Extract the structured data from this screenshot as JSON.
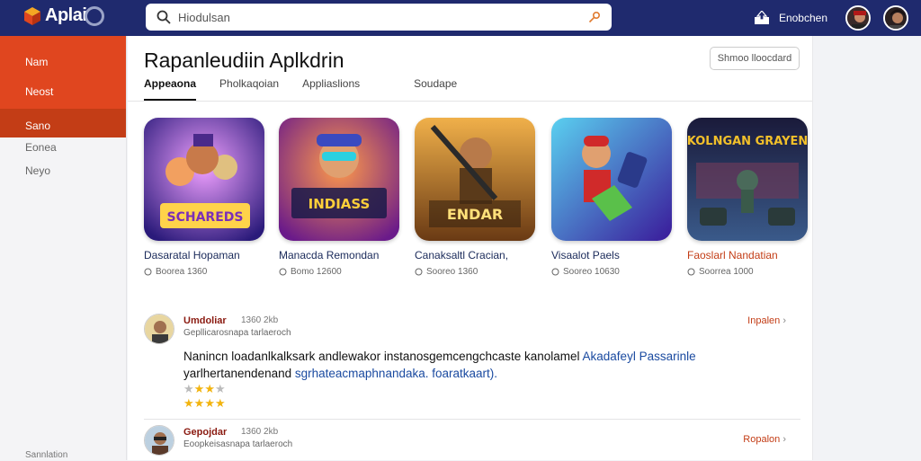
{
  "app": {
    "logo_text": "Aplai"
  },
  "search": {
    "value": "Hiodulsan"
  },
  "top_right": {
    "label": "Enobchen"
  },
  "sidebar": {
    "items": [
      {
        "label": "Nam"
      },
      {
        "label": "Neost"
      }
    ],
    "active": {
      "label": "Sano"
    },
    "plain": [
      {
        "label": "Eonea"
      },
      {
        "label": "Neyo"
      }
    ],
    "footer": "Sannlation"
  },
  "main": {
    "title": "Rapanleudiin Aplkdrin",
    "filter_button": "Shmoo lloocdard",
    "tabs": [
      {
        "label": "Appeaona"
      },
      {
        "label": "Pholkaqoian"
      },
      {
        "label": "Appliaslions"
      },
      {
        "label": "Soudape"
      }
    ]
  },
  "cards": [
    {
      "title": "Dasaratal Hopaman",
      "meta": "Boorea 1360",
      "art_text": "SCHAREDS",
      "accent": "#7a2fb8"
    },
    {
      "title": "Manacda Remondan",
      "meta": "Bomo 12600",
      "art_text": "INDIASS",
      "accent": "#e0462f"
    },
    {
      "title": "Canaksaltl Cracian,",
      "meta": "Sooreo 1360",
      "art_text": "ENDAR",
      "accent": "#d9841c"
    },
    {
      "title": "Visaalot Paels",
      "meta": "Sooreo 10630",
      "art_text": "",
      "accent": "#2fa6e0"
    },
    {
      "title": "Faoslarl Nandatian",
      "meta": "Soorrea 1000",
      "art_text": "KOLNGAN GRAYEN",
      "accent": "#d9b022"
    }
  ],
  "reviews": [
    {
      "name": "Umdoliar",
      "meta": "1360 2kb",
      "sub": "Gepllicarosnapa tarlaeroch",
      "link": "Inpalen",
      "body_black": "Nanincn loadanlkalksark andlewakor instanosgemcengchcaste kanolamel",
      "body_blue": "Akadafeyl Passarinle",
      "body_black2": "yarlhertanendenand",
      "body_blue2": "sgrhateacmaphnandaka. foaratkaart).",
      "rating": 3.5
    },
    {
      "name": "Gepojdar",
      "meta": "1360 2kb",
      "sub": "Eoopkeisasnapa tarlaeroch",
      "link": "Ropalon"
    }
  ],
  "colors": {
    "topbar": "#1f2a6e",
    "accent": "#e0461f",
    "link": "#c33d16"
  }
}
